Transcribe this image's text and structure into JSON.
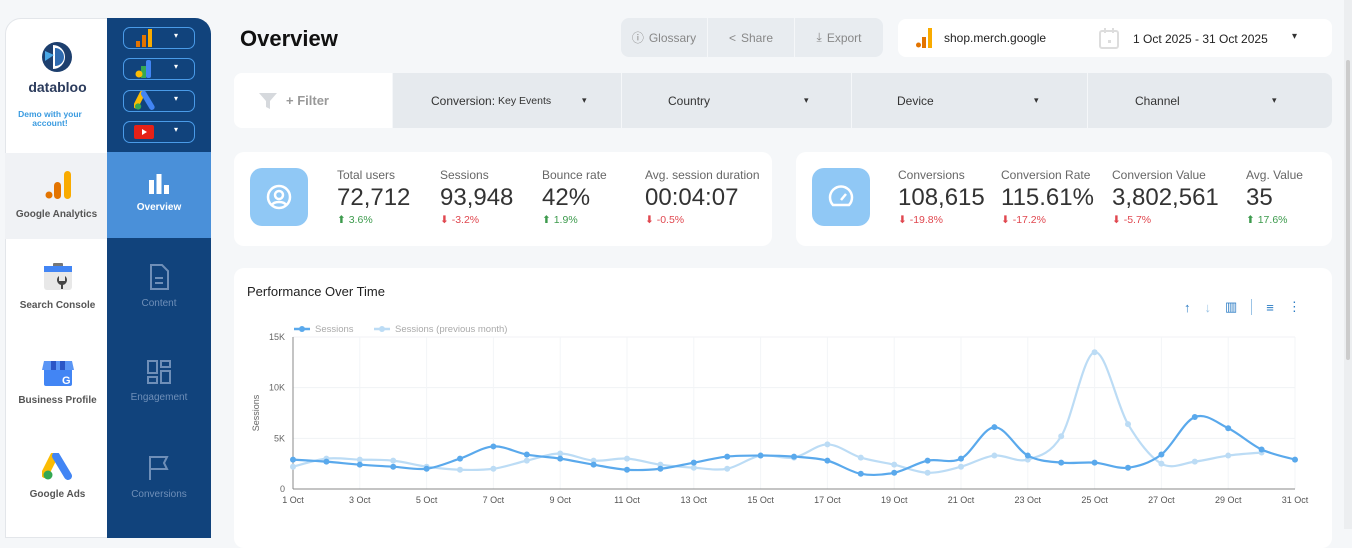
{
  "brand": {
    "name": "databloo",
    "demo_note": "Demo with your account!"
  },
  "source_selectors": [
    {
      "icon": "google-analytics-icon"
    },
    {
      "icon": "looker-icon"
    },
    {
      "icon": "google-ads-icon"
    },
    {
      "icon": "youtube-icon"
    }
  ],
  "sources": [
    {
      "label": "Google Analytics",
      "active": true
    },
    {
      "label": "Search Console"
    },
    {
      "label": "Business Profile"
    },
    {
      "label": "Google Ads"
    }
  ],
  "nav": [
    {
      "label": "Overview",
      "active": true
    },
    {
      "label": "Content"
    },
    {
      "label": "Engagement"
    },
    {
      "label": "Conversions"
    }
  ],
  "header": {
    "title": "Overview",
    "glossary": "Glossary",
    "share": "Share",
    "export": "Export",
    "property": "shop.merch.google",
    "date_range": "1 Oct 2025 - 31 Oct 2025"
  },
  "filters": {
    "add": "+ Filter",
    "conversion_label": "Conversion:",
    "conversion_value": "Key Events",
    "country": "Country",
    "device": "Device",
    "channel": "Channel"
  },
  "kpis_traffic": [
    {
      "label": "Total users",
      "value": "72,712",
      "change": "3.6%",
      "dir": "up"
    },
    {
      "label": "Sessions",
      "value": "93,948",
      "change": "-3.2%",
      "dir": "down"
    },
    {
      "label": "Bounce rate",
      "value": "42%",
      "change": "1.9%",
      "dir": "up"
    },
    {
      "label": "Avg. session duration",
      "value": "00:04:07",
      "change": "-0.5%",
      "dir": "down"
    }
  ],
  "kpis_conversion": [
    {
      "label": "Conversions",
      "value": "108,615",
      "change": "-19.8%",
      "dir": "down"
    },
    {
      "label": "Conversion Rate",
      "value": "115.61%",
      "change": "-17.2%",
      "dir": "down"
    },
    {
      "label": "Conversion Value",
      "value": "3,802,561",
      "change": "-5.7%",
      "dir": "down"
    },
    {
      "label": "Avg. Value",
      "value": "35",
      "change": "17.6%",
      "dir": "up"
    }
  ],
  "colors": {
    "dark_nav": "#11437c",
    "active_nav": "#4a90d9",
    "series": "#5aa9ec",
    "series_prev": "#bcdcf5",
    "up": "#3c9a4c",
    "down": "#e0474f"
  },
  "chart_data": {
    "type": "line",
    "title": "Performance Over Time",
    "ylabel": "Sessions",
    "xlabel": "",
    "ylim": [
      0,
      15000
    ],
    "yticks": [
      "0",
      "5K",
      "10K",
      "15K"
    ],
    "xticks": [
      "1 Oct",
      "3 Oct",
      "5 Oct",
      "7 Oct",
      "9 Oct",
      "11 Oct",
      "13 Oct",
      "15 Oct",
      "17 Oct",
      "19 Oct",
      "21 Oct",
      "23 Oct",
      "25 Oct",
      "27 Oct",
      "29 Oct",
      "31 Oct"
    ],
    "x": [
      1,
      2,
      3,
      4,
      5,
      6,
      7,
      8,
      9,
      10,
      11,
      12,
      13,
      14,
      15,
      16,
      17,
      18,
      19,
      20,
      21,
      22,
      23,
      24,
      25,
      26,
      27,
      28,
      29,
      30,
      31
    ],
    "legend": "top-left",
    "grid": true,
    "series": [
      {
        "name": "Sessions",
        "values": [
          2900,
          2700,
          2400,
          2200,
          2000,
          3000,
          4200,
          3400,
          3000,
          2400,
          1900,
          2000,
          2600,
          3200,
          3300,
          3200,
          2800,
          1500,
          1600,
          2800,
          3000,
          6100,
          3300,
          2600,
          2600,
          2100,
          3400,
          7100,
          6000,
          3900,
          2900
        ]
      },
      {
        "name": "Sessions (previous month)",
        "values": [
          2200,
          3000,
          2900,
          2800,
          2200,
          1900,
          2000,
          2800,
          3500,
          2800,
          3000,
          2400,
          2100,
          2000,
          3300,
          3100,
          4400,
          3100,
          2400,
          1600,
          2200,
          3300,
          2900,
          5200,
          13500,
          6400,
          2500,
          2700,
          3300,
          3600
        ]
      }
    ]
  }
}
